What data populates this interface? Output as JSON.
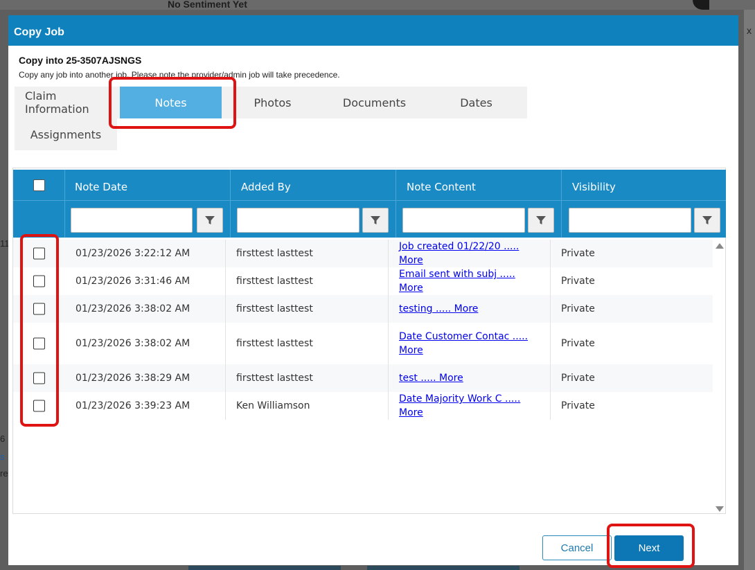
{
  "background": {
    "sentiment_text": "No Sentiment Yet",
    "left_fragments": [
      "11",
      "6",
      "s",
      "re"
    ],
    "right_fragment": "x"
  },
  "modal": {
    "title": "Copy Job",
    "copy_into": "Copy into 25-3507AJSNGS",
    "description": "Copy any job into another job. Please note the provider/admin job will take precedence."
  },
  "tabs": [
    {
      "label": "Claim Information",
      "active": false
    },
    {
      "label": "Notes",
      "active": true
    },
    {
      "label": "Photos",
      "active": false
    },
    {
      "label": "Documents",
      "active": false
    },
    {
      "label": "Dates",
      "active": false
    },
    {
      "label": "Assignments",
      "active": false
    }
  ],
  "grid": {
    "columns": [
      "Note Date",
      "Added By",
      "Note Content",
      "Visibility"
    ],
    "rows": [
      {
        "date": "01/23/2026 3:22:12 AM",
        "added_by": "firsttest lasttest",
        "content": "Job created 01/22/20 ..... More",
        "visibility": "Private"
      },
      {
        "date": "01/23/2026 3:31:46 AM",
        "added_by": "firsttest lasttest",
        "content": "Email sent with subj ..... More",
        "visibility": "Private"
      },
      {
        "date": "01/23/2026 3:38:02 AM",
        "added_by": "firsttest lasttest",
        "content": "testing ..... More",
        "visibility": "Private"
      },
      {
        "date": "01/23/2026 3:38:02 AM",
        "added_by": "firsttest lasttest",
        "content": "Date Customer Contac ..... More",
        "visibility": "Private"
      },
      {
        "date": "01/23/2026 3:38:29 AM",
        "added_by": "firsttest lasttest",
        "content": "test ..... More",
        "visibility": "Private"
      },
      {
        "date": "01/23/2026 3:39:23 AM",
        "added_by": "Ken Williamson",
        "content": "Date Majority Work C ..... More",
        "visibility": "Private"
      }
    ]
  },
  "footer": {
    "cancel_label": "Cancel",
    "next_label": "Next"
  },
  "colors": {
    "header_blue": "#0f82be",
    "grid_header_blue": "#1a8ac4",
    "active_tab": "#53afe1",
    "highlight_red": "#e01313",
    "link_blue": "#0000ee"
  }
}
